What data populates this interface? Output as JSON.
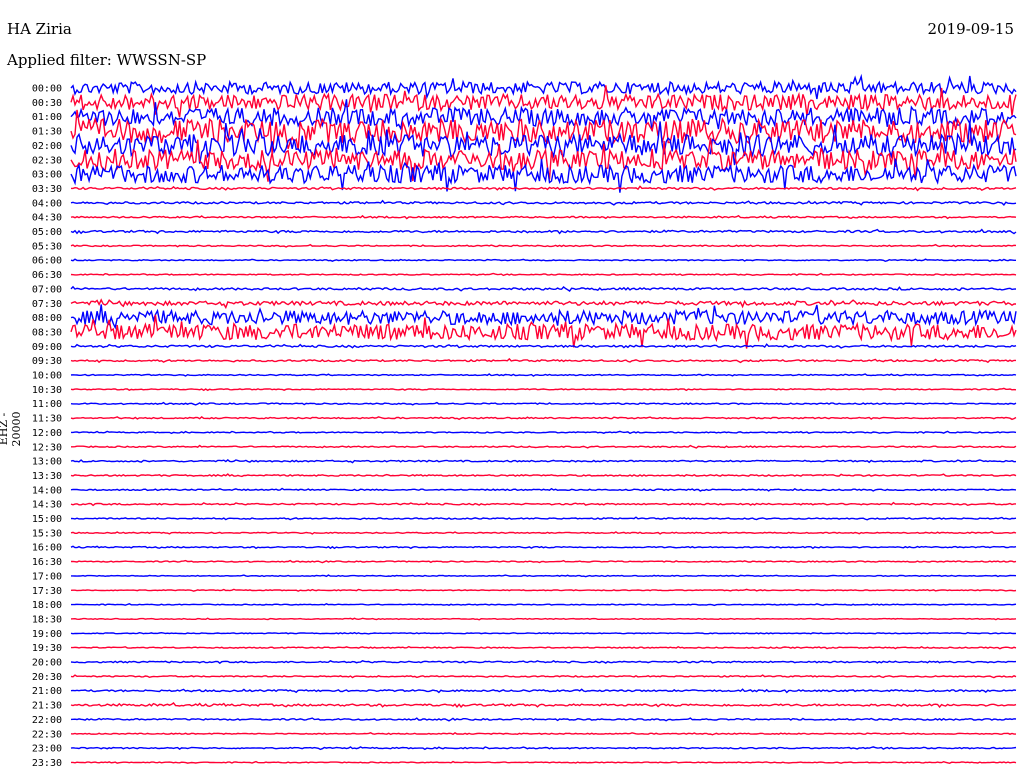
{
  "header": {
    "station": "HA Ziria",
    "date": "2019-09-15",
    "filter": "Applied filter: WWSSN-SP",
    "channel": "EHZ - 20000"
  },
  "chart_data": {
    "type": "line",
    "title": "HA Ziria",
    "colors": [
      "#0000ff",
      "#ff0033"
    ],
    "rows": [
      {
        "label": "00:00",
        "amp": 6
      },
      {
        "label": "00:30",
        "amp": 8
      },
      {
        "label": "01:00",
        "amp": 9
      },
      {
        "label": "01:30",
        "amp": 12
      },
      {
        "label": "02:00",
        "amp": 11
      },
      {
        "label": "02:30",
        "amp": 10
      },
      {
        "label": "03:00",
        "amp": 9
      },
      {
        "label": "03:30",
        "amp": 1
      },
      {
        "label": "04:00",
        "amp": 1
      },
      {
        "label": "04:30",
        "amp": 0.7
      },
      {
        "label": "05:00",
        "amp": 1
      },
      {
        "label": "05:30",
        "amp": 0.6
      },
      {
        "label": "06:00",
        "amp": 0.5
      },
      {
        "label": "06:30",
        "amp": 0.5
      },
      {
        "label": "07:00",
        "amp": 1
      },
      {
        "label": "07:30",
        "amp": 2
      },
      {
        "label": "08:00",
        "amp": 7
      },
      {
        "label": "08:30",
        "amp": 8
      },
      {
        "label": "09:00",
        "amp": 1
      },
      {
        "label": "09:30",
        "amp": 0.8
      },
      {
        "label": "10:00",
        "amp": 0.5
      },
      {
        "label": "10:30",
        "amp": 0.5
      },
      {
        "label": "11:00",
        "amp": 0.6
      },
      {
        "label": "11:30",
        "amp": 0.6
      },
      {
        "label": "12:00",
        "amp": 0.5
      },
      {
        "label": "12:30",
        "amp": 0.6
      },
      {
        "label": "13:00",
        "amp": 0.7
      },
      {
        "label": "13:30",
        "amp": 0.7
      },
      {
        "label": "14:00",
        "amp": 0.6
      },
      {
        "label": "14:30",
        "amp": 0.7
      },
      {
        "label": "15:00",
        "amp": 0.6
      },
      {
        "label": "15:30",
        "amp": 0.5
      },
      {
        "label": "16:00",
        "amp": 0.6
      },
      {
        "label": "16:30",
        "amp": 0.5
      },
      {
        "label": "17:00",
        "amp": 0.4
      },
      {
        "label": "17:30",
        "amp": 0.4
      },
      {
        "label": "18:00",
        "amp": 0.4
      },
      {
        "label": "18:30",
        "amp": 0.4
      },
      {
        "label": "19:00",
        "amp": 0.4
      },
      {
        "label": "19:30",
        "amp": 0.5
      },
      {
        "label": "20:00",
        "amp": 0.7
      },
      {
        "label": "20:30",
        "amp": 0.6
      },
      {
        "label": "21:00",
        "amp": 0.8
      },
      {
        "label": "21:30",
        "amp": 1
      },
      {
        "label": "22:00",
        "amp": 0.7
      },
      {
        "label": "22:30",
        "amp": 0.5
      },
      {
        "label": "23:00",
        "amp": 0.6
      },
      {
        "label": "23:30",
        "amp": 0.4
      }
    ]
  }
}
